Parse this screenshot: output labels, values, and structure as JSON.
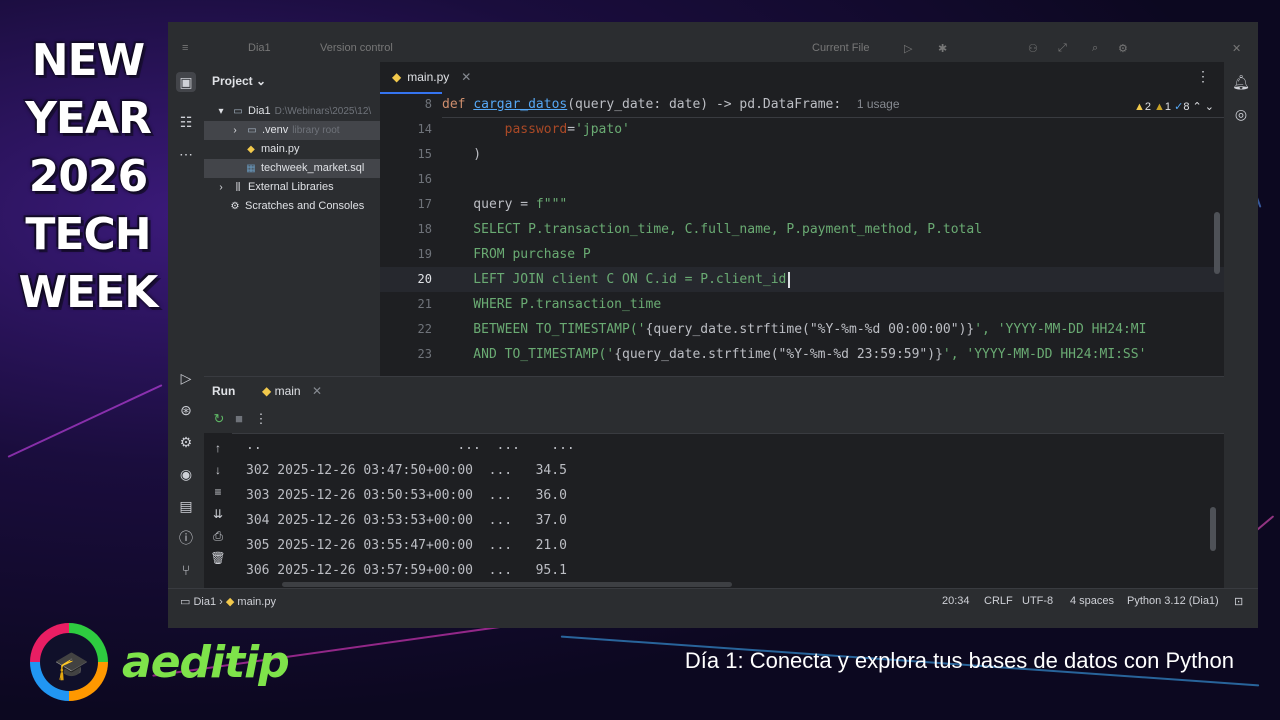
{
  "event": {
    "lines": [
      "NEW",
      "YEAR",
      "2026",
      "TECH",
      "WEEK"
    ]
  },
  "brand": {
    "name": "aeditip",
    "accent": "#7ee34a"
  },
  "caption": "Día 1: Conecta y explora tus bases de datos con Python",
  "ide": {
    "top": {
      "project": "Dia1",
      "vcs": "Version control",
      "run_config": "Current File"
    },
    "left_strip": [
      "folder-icon",
      "structure-icon",
      "more-icon",
      "run-icon",
      "python-packages-icon",
      "services-icon",
      "debug-icon",
      "terminal-icon",
      "problems-icon",
      "git-icon"
    ],
    "project_panel": {
      "title": "Project",
      "tree": [
        {
          "label": "Dia1",
          "hint": "D:\\Webinars\\2025\\12\\",
          "icon": "folder",
          "indent": 0,
          "arrow": "▾"
        },
        {
          "label": ".venv",
          "hint": "library root",
          "icon": "folder",
          "indent": 1,
          "arrow": "›",
          "selected": true
        },
        {
          "label": "main.py",
          "hint": "",
          "icon": "python",
          "indent": 2,
          "arrow": ""
        },
        {
          "label": "techweek_market.sql",
          "hint": "",
          "icon": "sql",
          "indent": 2,
          "arrow": "",
          "selected": true
        },
        {
          "label": "External Libraries",
          "hint": "",
          "icon": "library",
          "indent": 0,
          "arrow": "›"
        },
        {
          "label": "Scratches and Consoles",
          "hint": "",
          "icon": "scratch",
          "indent": 0,
          "arrow": ""
        }
      ]
    },
    "editor": {
      "tab": "main.py",
      "inspections": {
        "warnings": "2",
        "weak": "1",
        "checks": "8"
      },
      "sticky": {
        "line": "8",
        "usage": "1 usage"
      },
      "lines": [
        {
          "n": "14",
          "text": ""
        },
        {
          "n": "15",
          "text": ""
        },
        {
          "n": "16",
          "text": ""
        },
        {
          "n": "17",
          "text": ""
        },
        {
          "n": "18",
          "text": ""
        },
        {
          "n": "19",
          "text": ""
        },
        {
          "n": "20",
          "text": ""
        },
        {
          "n": "21",
          "text": ""
        },
        {
          "n": "22",
          "text": ""
        },
        {
          "n": "23",
          "text": ""
        }
      ],
      "code": {
        "l8_def": "def ",
        "l8_fn": "cargar_datos",
        "l8_rest": "(query_date: date) -> pd.DataFrame:",
        "l14_pad": "        ",
        "l14_param": "password",
        "l14_eq": "=",
        "l14_str": "'jpato'",
        "l15": "    )",
        "l16": "",
        "l17_a": "    query = ",
        "l17_str": "f\"\"\"",
        "l18": "    SELECT P.transaction_time, C.full_name, P.payment_method, P.total",
        "l19": "    FROM purchase P",
        "l20": "    LEFT JOIN client C ON C.id = P.client_id",
        "l21": "    WHERE P.transaction_time",
        "l22_a": "    BETWEEN TO_TIMESTAMP('",
        "l22_b": "{query_date.strftime(\"%Y-%m-%d 00:00:00\")}",
        "l22_c": "', 'YYYY-MM-DD HH24:MI",
        "l23_a": "    AND TO_TIMESTAMP('",
        "l23_b": "{query_date.strftime(\"%Y-%m-%d 23:59:59\")}",
        "l23_c": "', 'YYYY-MM-DD HH24:MI:SS'"
      }
    },
    "run": {
      "title": "Run",
      "tab": "main",
      "output": [
        "..                         ...  ...    ...",
        "302 2025-12-26 03:47:50+00:00  ...   34.5",
        "303 2025-12-26 03:50:53+00:00  ...   36.0",
        "304 2025-12-26 03:53:53+00:00  ...   37.0",
        "305 2025-12-26 03:55:47+00:00  ...   21.0",
        "306 2025-12-26 03:57:59+00:00  ...   95.1"
      ]
    },
    "status": {
      "crumb_project": "Dia1",
      "crumb_file": "main.py",
      "position": "20:34",
      "line_sep": "CRLF",
      "encoding": "UTF-8",
      "indent": "4 spaces",
      "interpreter": "Python 3.12 (Dia1)"
    }
  }
}
